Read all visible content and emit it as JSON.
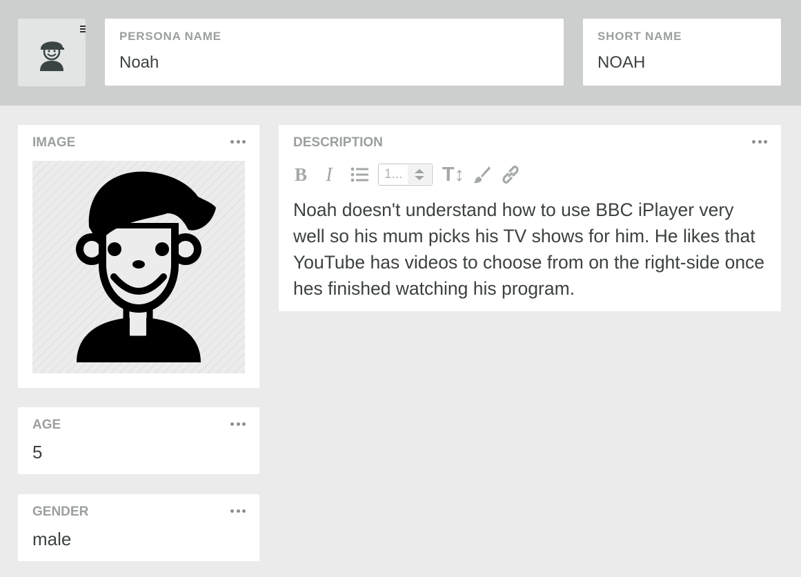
{
  "header": {
    "persona_name": {
      "label": "PERSONA NAME",
      "value": "Noah"
    },
    "short_name": {
      "label": "SHORT NAME",
      "value": "NOAH"
    }
  },
  "image_card": {
    "label": "IMAGE",
    "menu_icon": "more-dots-icon",
    "avatar_icon": "boy-avatar-icon"
  },
  "description_card": {
    "label": "DESCRIPTION",
    "toolbar": {
      "bold": "B",
      "italic": "I",
      "list_icon": "bullet-list-icon",
      "heading_select_value": "1...",
      "text_size": "T↕",
      "brush_icon": "paint-brush-icon",
      "link_icon": "link-icon"
    },
    "text": "Noah doesn't understand how to use BBC iPlayer very well so his mum picks his TV shows for him. He likes that YouTube has videos to choose from on the right-side once hes finished watching his program."
  },
  "age_card": {
    "label": "AGE",
    "value": "5"
  },
  "gender_card": {
    "label": "GENDER",
    "value": "male"
  },
  "colors": {
    "header_bg": "#cdcfce",
    "page_bg": "#ebebeb",
    "label_gray": "#9b9f9e",
    "text_dark": "#3d4141"
  }
}
